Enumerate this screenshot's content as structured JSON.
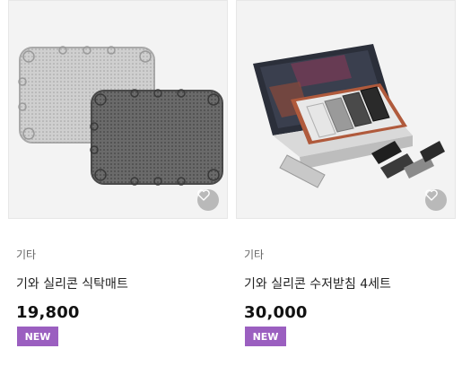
{
  "products": [
    {
      "category": "기타",
      "name": "기와 실리콘 식탁매트",
      "price": "19,800",
      "badge": "NEW",
      "image": "grey-silicone-table-mats",
      "wish_icon": "heart-outline-icon"
    },
    {
      "category": "기타",
      "name": "기와 실리콘 수저받침 4세트",
      "price": "30,000",
      "badge": "NEW",
      "image": "silicone-spoon-rest-gift-box",
      "wish_icon": "heart-outline-icon"
    }
  ],
  "colors": {
    "badge_bg": "#9b5fc0",
    "thumb_bg": "#f3f3f3",
    "wish_bg": "#b9b9b9"
  }
}
